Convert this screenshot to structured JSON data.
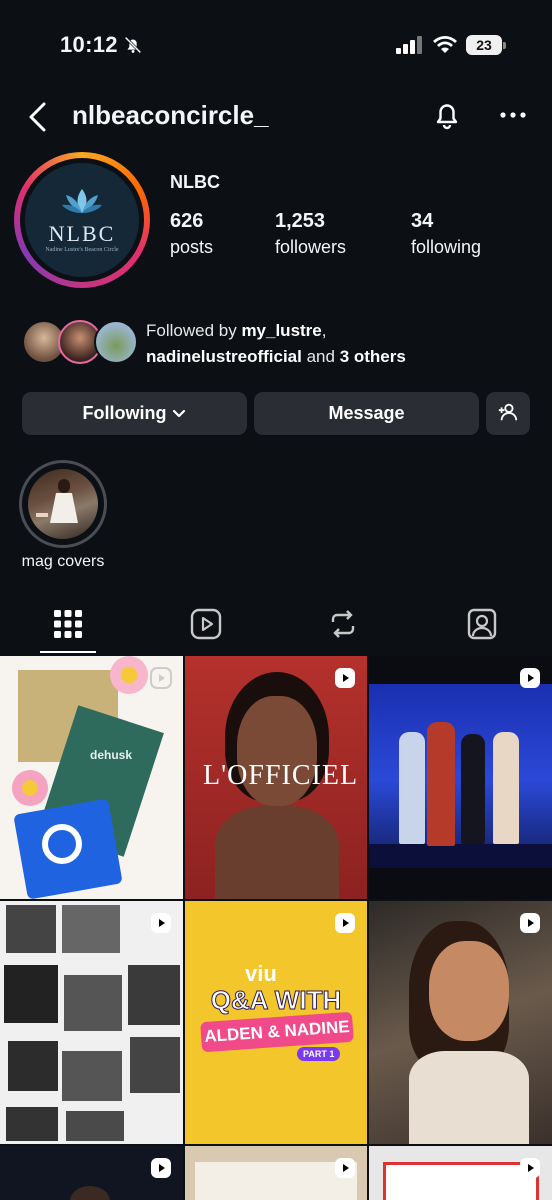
{
  "status_bar": {
    "time": "10:12",
    "battery": "23"
  },
  "header": {
    "handle": "nlbeaconcircle_"
  },
  "profile": {
    "display_name": "NLBC",
    "avatar_text": "NLBC",
    "avatar_subtext": "Nadine Lustre's Beacon Circle",
    "stats": [
      {
        "value": "626",
        "label": "posts"
      },
      {
        "value": "1,253",
        "label": "followers"
      },
      {
        "value": "34",
        "label": "following"
      }
    ],
    "followed_by": {
      "prefix": "Followed by ",
      "user1": "my_lustre",
      "sep": ",",
      "user2": "nadinelustreofficial",
      "and": " and ",
      "others": "3 others"
    }
  },
  "actions": {
    "following": "Following",
    "message": "Message"
  },
  "highlights": [
    {
      "label": "mag covers"
    }
  ],
  "grid": {
    "post2_text": "L'OFFICIEL",
    "post5_brand": "viu",
    "post5_title": "Q&A WITH",
    "post5_subtitle": "ALDEN & NADINE",
    "post5_part": "PART 1",
    "post1_brand": "dehusk"
  },
  "colors": {
    "background": "#0c0f14",
    "button": "#2a2d33",
    "text": "#f4f5f6"
  }
}
